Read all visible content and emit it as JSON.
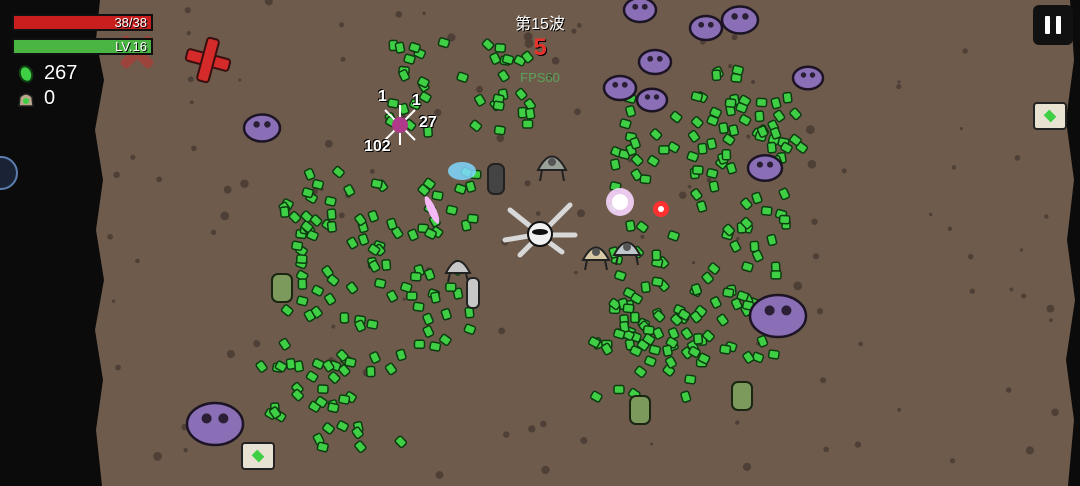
{
  "hud": {
    "hp": {
      "text": "38/38",
      "current": 38,
      "max": 38
    },
    "level": {
      "text": "LV.16",
      "xp_fraction": 1.0
    },
    "materials": {
      "icon": "green-material-icon",
      "count": "267"
    },
    "bag": {
      "icon": "material-bag-icon",
      "count": "0"
    }
  },
  "wave": {
    "label": "第15波",
    "timer": "5"
  },
  "fps": "FPS60",
  "damage_numbers": [
    "1",
    "1",
    "27",
    "102"
  ],
  "colors": {
    "ground": "#6e5b4c",
    "material_green": "#3fcf45",
    "enemy_purple": "#8a6fb6",
    "hp_red": "#c81e1e",
    "xp_green": "#4bb543"
  },
  "controls": {
    "pause_icon": "pause-icon"
  }
}
